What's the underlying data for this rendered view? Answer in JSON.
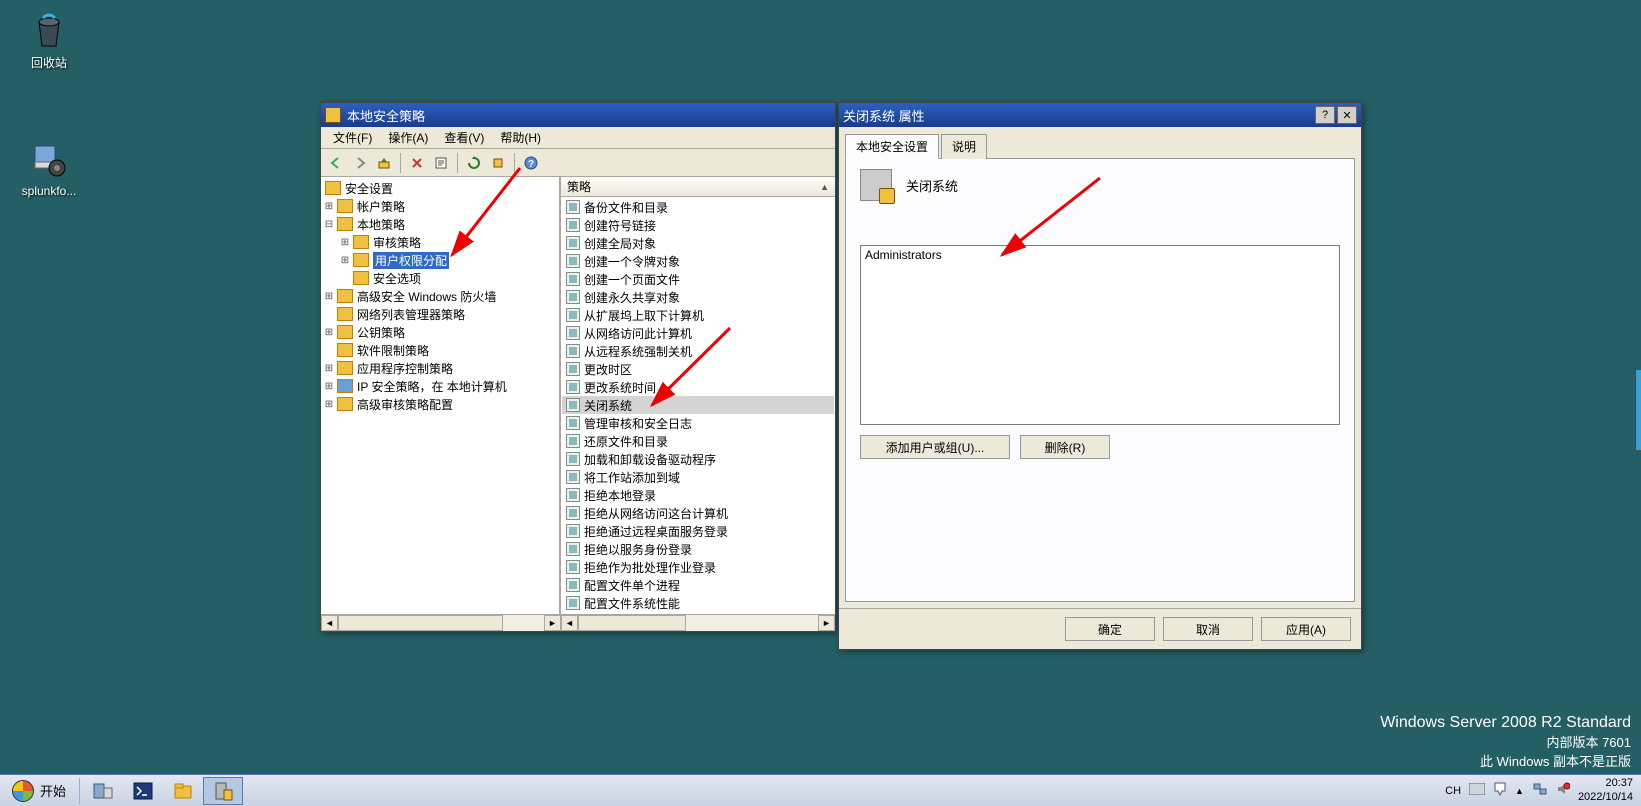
{
  "desktop": {
    "recycle_bin": "回收站",
    "splunk": "splunkfo..."
  },
  "secpol": {
    "title": "本地安全策略",
    "menus": {
      "file": "文件(F)",
      "action": "操作(A)",
      "view": "查看(V)",
      "help": "帮助(H)"
    },
    "tree_root": "安全设置",
    "tree": {
      "account": "帐户策略",
      "local": "本地策略",
      "audit": "审核策略",
      "user_rights": "用户权限分配",
      "sec_options": "安全选项",
      "wfas": "高级安全 Windows 防火墙",
      "nlm": "网络列表管理器策略",
      "pubkey": "公钥策略",
      "srp": "软件限制策略",
      "appctrl": "应用程序控制策略",
      "ipsec": "IP 安全策略，在 本地计算机",
      "advaudit": "高级审核策略配置"
    },
    "list_header": "策略",
    "list": [
      "备份文件和目录",
      "创建符号链接",
      "创建全局对象",
      "创建一个令牌对象",
      "创建一个页面文件",
      "创建永久共享对象",
      "从扩展坞上取下计算机",
      "从网络访问此计算机",
      "从远程系统强制关机",
      "更改时区",
      "更改系统时间",
      "关闭系统",
      "管理审核和安全日志",
      "还原文件和目录",
      "加载和卸载设备驱动程序",
      "将工作站添加到域",
      "拒绝本地登录",
      "拒绝从网络访问这台计算机",
      "拒绝通过远程桌面服务登录",
      "拒绝以服务身份登录",
      "拒绝作为批处理作业登录",
      "配置文件单个进程",
      "配置文件系统性能"
    ],
    "selected_index": 11
  },
  "dlg": {
    "title": "关闭系统 属性",
    "tab_security": "本地安全设置",
    "tab_explain": "说明",
    "policy_name": "关闭系统",
    "user_list": [
      "Administrators"
    ],
    "btn_add": "添加用户或组(U)...",
    "btn_remove": "删除(R)",
    "btn_ok": "确定",
    "btn_cancel": "取消",
    "btn_apply": "应用(A)"
  },
  "watermark": {
    "line1": "Windows Server 2008 R2 Standard",
    "line2": "内部版本 7601",
    "line3": "此 Windows 副本不是正版"
  },
  "taskbar": {
    "start": "开始",
    "ime": "CH",
    "time": "20:37",
    "date": "2022/10/14"
  }
}
